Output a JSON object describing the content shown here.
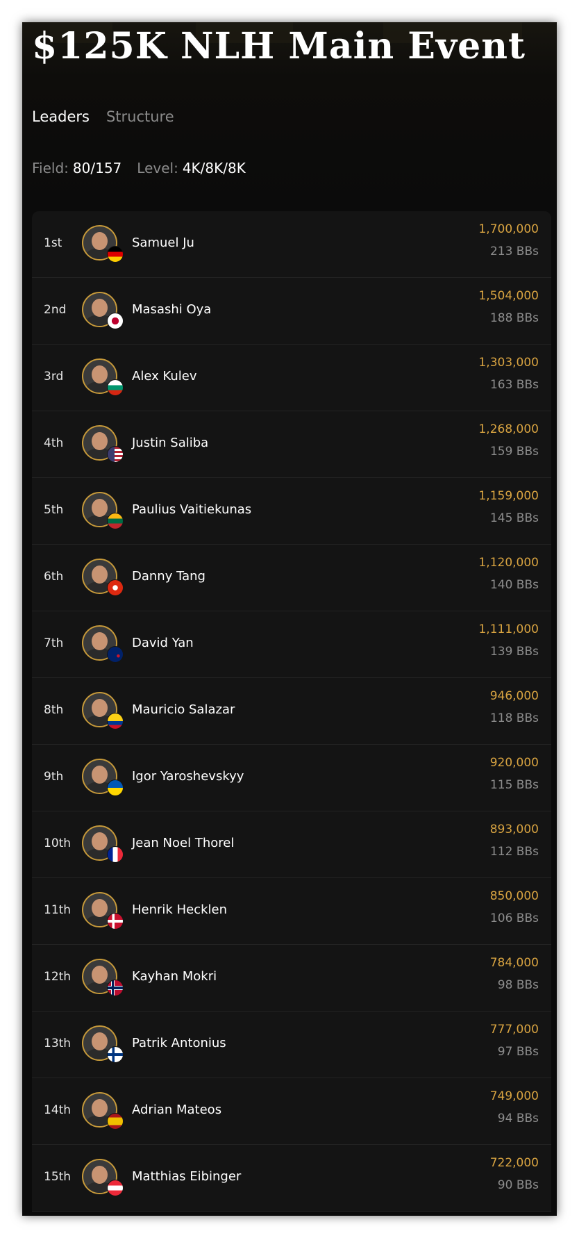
{
  "event": {
    "title": "$125K NLH Main Event"
  },
  "tabs": [
    {
      "label": "Leaders",
      "active": true
    },
    {
      "label": "Structure",
      "active": false
    }
  ],
  "info": {
    "field_label": "Field:",
    "field_value": "80/157",
    "level_label": "Level:",
    "level_value": "4K/8K/8K"
  },
  "colors": {
    "accent_gold": "#d9a441",
    "avatar_ring": "#c79a3a",
    "background": "#0b0b0b",
    "row_bg": "#141414"
  },
  "players": [
    {
      "rank": "1st",
      "name": "Samuel Ju",
      "chips": "1,700,000",
      "bbs": "213 BBs",
      "flag": "germany-flag-icon",
      "flag_css": "linear-gradient(#000 33%, #dd0000 33% 66%, #ffce00 66%)"
    },
    {
      "rank": "2nd",
      "name": "Masashi Oya",
      "chips": "1,504,000",
      "bbs": "188 BBs",
      "flag": "japan-flag-icon",
      "flag_css": "radial-gradient(circle, #bc002d 32%, #ffffff 34%)"
    },
    {
      "rank": "3rd",
      "name": "Alex Kulev",
      "chips": "1,303,000",
      "bbs": "163 BBs",
      "flag": "bulgaria-flag-icon",
      "flag_css": "linear-gradient(#ffffff 33%, #00966e 33% 66%, #d62612 66%)"
    },
    {
      "rank": "4th",
      "name": "Justin Saliba",
      "chips": "1,268,000",
      "bbs": "159 BBs",
      "flag": "usa-flag-icon",
      "flag_css": "linear-gradient(90deg, #3c3b6e 45%, transparent 45%), repeating-linear-gradient(#b22234 0 3px, #ffffff 3px 6px)"
    },
    {
      "rank": "5th",
      "name": "Paulius Vaitiekunas",
      "chips": "1,159,000",
      "bbs": "145 BBs",
      "flag": "lithuania-flag-icon",
      "flag_css": "linear-gradient(#fdb913 33%, #006a44 33% 66%, #c1272d 66%)"
    },
    {
      "rank": "6th",
      "name": "Danny Tang",
      "chips": "1,120,000",
      "bbs": "140 BBs",
      "flag": "hong-kong-flag-icon",
      "flag_css": "radial-gradient(circle, #ffffff 22%, #de2910 26%)"
    },
    {
      "rank": "7th",
      "name": "David Yan",
      "chips": "1,111,000",
      "bbs": "139 BBs",
      "flag": "new-zealand-flag-icon",
      "flag_css": "radial-gradient(circle at 70% 60%, #cc142b 10%, transparent 12%), linear-gradient(135deg, #ffffff 0 10%, #012169 10%)"
    },
    {
      "rank": "8th",
      "name": "Mauricio Salazar",
      "chips": "946,000",
      "bbs": "118 BBs",
      "flag": "colombia-flag-icon",
      "flag_css": "linear-gradient(#fcd116 50%, #003893 50% 75%, #ce1126 75%)"
    },
    {
      "rank": "9th",
      "name": "Igor Yaroshevskyy",
      "chips": "920,000",
      "bbs": "115 BBs",
      "flag": "ukraine-flag-icon",
      "flag_css": "linear-gradient(#0057b7 50%, #ffd700 50%)"
    },
    {
      "rank": "10th",
      "name": "Jean Noel Thorel",
      "chips": "893,000",
      "bbs": "112 BBs",
      "flag": "france-flag-icon",
      "flag_css": "linear-gradient(90deg, #002395 33%, #ffffff 33% 66%, #ed2939 66%)"
    },
    {
      "rank": "11th",
      "name": "Henrik Hecklen",
      "chips": "850,000",
      "bbs": "106 BBs",
      "flag": "denmark-flag-icon",
      "flag_css": "linear-gradient(90deg, transparent 30%, #ffffff 30% 45%, transparent 45%), linear-gradient(transparent 40%, #ffffff 40% 58%, #c8102e 58%), #c8102e"
    },
    {
      "rank": "12th",
      "name": "Kayhan Mokri",
      "chips": "784,000",
      "bbs": "98 BBs",
      "flag": "norway-flag-icon",
      "flag_css": "linear-gradient(90deg, transparent 28%, #00205b 28% 40%, transparent 40%), linear-gradient(transparent 42%, #00205b 42% 58%, transparent 58%), linear-gradient(90deg, transparent 22%, #ffffff 22% 46%, transparent 46%), linear-gradient(transparent 36%, #ffffff 36% 64%, transparent 64%), #ba0c2f"
    },
    {
      "rank": "13th",
      "name": "Patrik Antonius",
      "chips": "777,000",
      "bbs": "97 BBs",
      "flag": "finland-flag-icon",
      "flag_css": "linear-gradient(90deg, transparent 30%, #003580 30% 46%, transparent 46%), linear-gradient(transparent 40%, #003580 40% 60%, transparent 60%), #ffffff"
    },
    {
      "rank": "14th",
      "name": "Adrian Mateos",
      "chips": "749,000",
      "bbs": "94 BBs",
      "flag": "spain-flag-icon",
      "flag_css": "linear-gradient(#aa151b 25%, #f1bf00 25% 75%, #aa151b 75%)"
    },
    {
      "rank": "15th",
      "name": "Matthias Eibinger",
      "chips": "722,000",
      "bbs": "90 BBs",
      "flag": "austria-flag-icon",
      "flag_css": "linear-gradient(#ed2939 33%, #ffffff 33% 66%, #ed2939 66%)"
    }
  ]
}
